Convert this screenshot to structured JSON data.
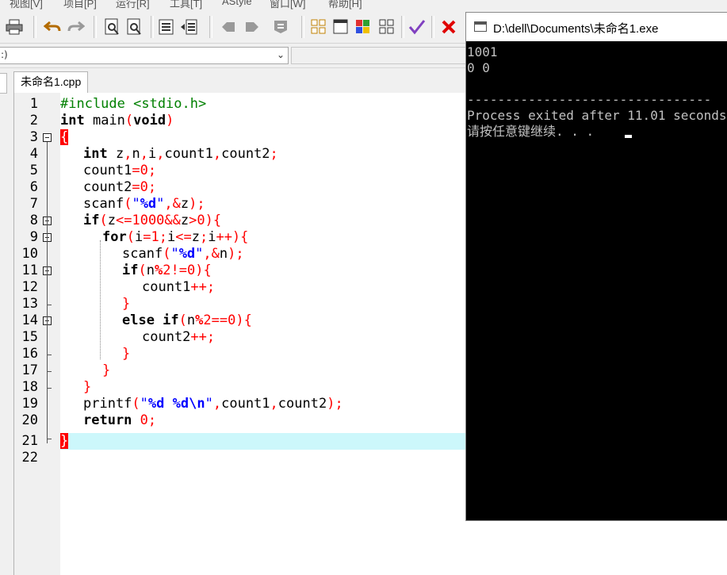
{
  "menu": [
    "视图[V]",
    "项目[P]",
    "运行[R]",
    "工具[T]",
    "AStyle",
    "窗口[W]",
    "帮助[H]"
  ],
  "combo": {
    "left_text": ":)"
  },
  "tab": {
    "label": "未命名1.cpp"
  },
  "editor": {
    "line_numbers": [
      "1",
      "2",
      "3",
      "4",
      "5",
      "6",
      "7",
      "8",
      "9",
      "10",
      "11",
      "12",
      "13",
      "14",
      "15",
      "16",
      "17",
      "18",
      "19",
      "20",
      "21",
      "22"
    ],
    "current_line": 21
  },
  "code": {
    "l1": "#include <stdio.h>",
    "l2_kw": "int",
    "l2_mid": " main",
    "l2_p1": "(",
    "l2_void": "void",
    "l2_p2": ")",
    "l3_brace": "{",
    "l4_kw": "int",
    "l4_rest": " z",
    "l4_c1": ",",
    "l4_n": "n",
    "l4_c2": ",",
    "l4_i": "i",
    "l4_c3": ",",
    "l4_c1v": "count1",
    "l4_c4": ",",
    "l4_c2v": "count2",
    "l4_semi": ";",
    "l5_a": "count1",
    "l5_eq": "=",
    "l5_n": "0",
    "l5_s": ";",
    "l6_a": "count2",
    "l6_eq": "=",
    "l6_n": "0",
    "l6_s": ";",
    "l7_a": "scanf",
    "l7_p": "(",
    "l7_str": "\"",
    "l7_fmt": "%d",
    "l7_str2": "\"",
    "l7_c": ",&",
    "l7_z": "z",
    "l7_e": ");",
    "l8_kw": "if",
    "l8_p": "(",
    "l8_z": "z",
    "l8_op": "<=",
    "l8_n": "1000",
    "l8_and": "&&",
    "l8_z2": "z",
    "l8_gt": ">",
    "l8_0": "0",
    "l8_e": "){",
    "l9_kw": "for",
    "l9_p": "(",
    "l9_a": "i",
    "l9_eq": "=",
    "l9_1": "1",
    "l9_s": ";",
    "l9_i": "i",
    "l9_le": "<=",
    "l9_z": "z",
    "l9_s2": ";",
    "l9_i2": "i",
    "l9_pp": "++){",
    "l10_a": "scanf",
    "l10_p": "(",
    "l10_str": "\"",
    "l10_fmt": "%d",
    "l10_str2": "\"",
    "l10_c": ",&",
    "l10_n": "n",
    "l10_e": ");",
    "l11_kw": "if",
    "l11_p": "(",
    "l11_n": "n",
    "l11_mod": "%",
    "l11_2": "2",
    "l11_ne": "!=",
    "l11_0": "0",
    "l11_e": "){",
    "l12_a": "count1",
    "l12_pp": "++;",
    "l13_b": "}",
    "l14_kw": "else if",
    "l14_p": "(",
    "l14_n": "n",
    "l14_mod": "%",
    "l14_2": "2",
    "l14_eq": "==",
    "l14_0": "0",
    "l14_e": "){",
    "l15_a": "count2",
    "l15_pp": "++;",
    "l16_b": "}",
    "l17_b": "}",
    "l18_b": "}",
    "l19_a": "printf",
    "l19_p": "(",
    "l19_q": "\"",
    "l19_f1": "%d",
    "l19_sp": " ",
    "l19_f2": "%d",
    "l19_nl": "\\n",
    "l19_q2": "\"",
    "l19_c": ",",
    "l19_v1": "count1",
    "l19_c2": ",",
    "l19_v2": "count2",
    "l19_e": ");",
    "l20_kw": "return",
    "l20_sp": " ",
    "l20_0": "0",
    "l20_s": ";",
    "l21_brace": "}"
  },
  "console": {
    "title": "D:\\dell\\Documents\\未命名1.exe",
    "lines": [
      "1001",
      "0 0",
      "",
      "--------------------------------",
      "Process exited after 11.01 seconds",
      "请按任意键继续. . ."
    ]
  },
  "icons": [
    "printer-icon",
    "undo-icon",
    "redo-icon",
    "find-icon",
    "replace-icon",
    "indent-icon",
    "unindent-icon",
    "bookmark-prev-icon",
    "bookmark-next-icon",
    "comment-icon",
    "grid-icon",
    "window-icon",
    "color-icon",
    "layout-icon",
    "check-icon",
    "close-icon"
  ]
}
